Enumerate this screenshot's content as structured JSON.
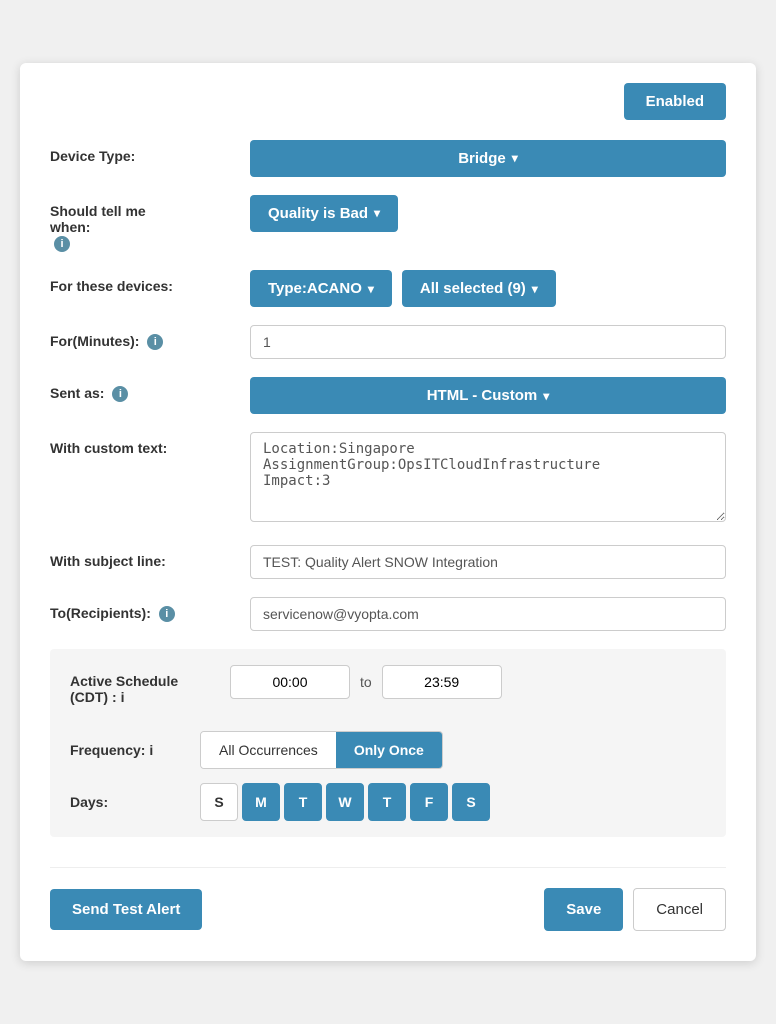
{
  "header": {
    "enabled_label": "Enabled"
  },
  "form": {
    "device_type_label": "Device Type:",
    "device_type_value": "Bridge",
    "should_tell_label_line1": "Should tell me",
    "should_tell_label_line2": "when:",
    "quality_value": "Quality is Bad",
    "for_devices_label": "For these devices:",
    "type_acano_label": "Type:ACANO",
    "all_selected_label": "All selected (9)",
    "for_minutes_label": "For(Minutes):",
    "for_minutes_value": "1",
    "sent_as_label": "Sent as:",
    "sent_as_value": "HTML - Custom",
    "custom_text_label": "With custom text:",
    "custom_text_value": "Location:Singapore\nAssignmentGroup:OpsITCloudInfrastructure\nImpact:3",
    "subject_line_label": "With subject line:",
    "subject_line_value": "TEST: Quality Alert SNOW Integration",
    "recipients_label": "To(Recipients):",
    "recipients_value": "servicenow@vyopta.com",
    "schedule_label_line1": "Active Schedule",
    "schedule_label_line2": "(CDT) :",
    "schedule_start": "00:00",
    "schedule_to": "to",
    "schedule_end": "23:59",
    "frequency_label": "Frequency:",
    "frequency_options": [
      {
        "label": "All Occurrences",
        "active": false
      },
      {
        "label": "Only Once",
        "active": true
      }
    ],
    "days_label": "Days:",
    "days": [
      {
        "label": "S",
        "active": false
      },
      {
        "label": "M",
        "active": true
      },
      {
        "label": "T",
        "active": true
      },
      {
        "label": "W",
        "active": true
      },
      {
        "label": "T",
        "active": true
      },
      {
        "label": "F",
        "active": true
      },
      {
        "label": "S",
        "active": true
      }
    ]
  },
  "buttons": {
    "send_test_label": "Send Test Alert",
    "save_label": "Save",
    "cancel_label": "Cancel"
  },
  "icons": {
    "info": "i",
    "dropdown_arrow": "▾"
  }
}
